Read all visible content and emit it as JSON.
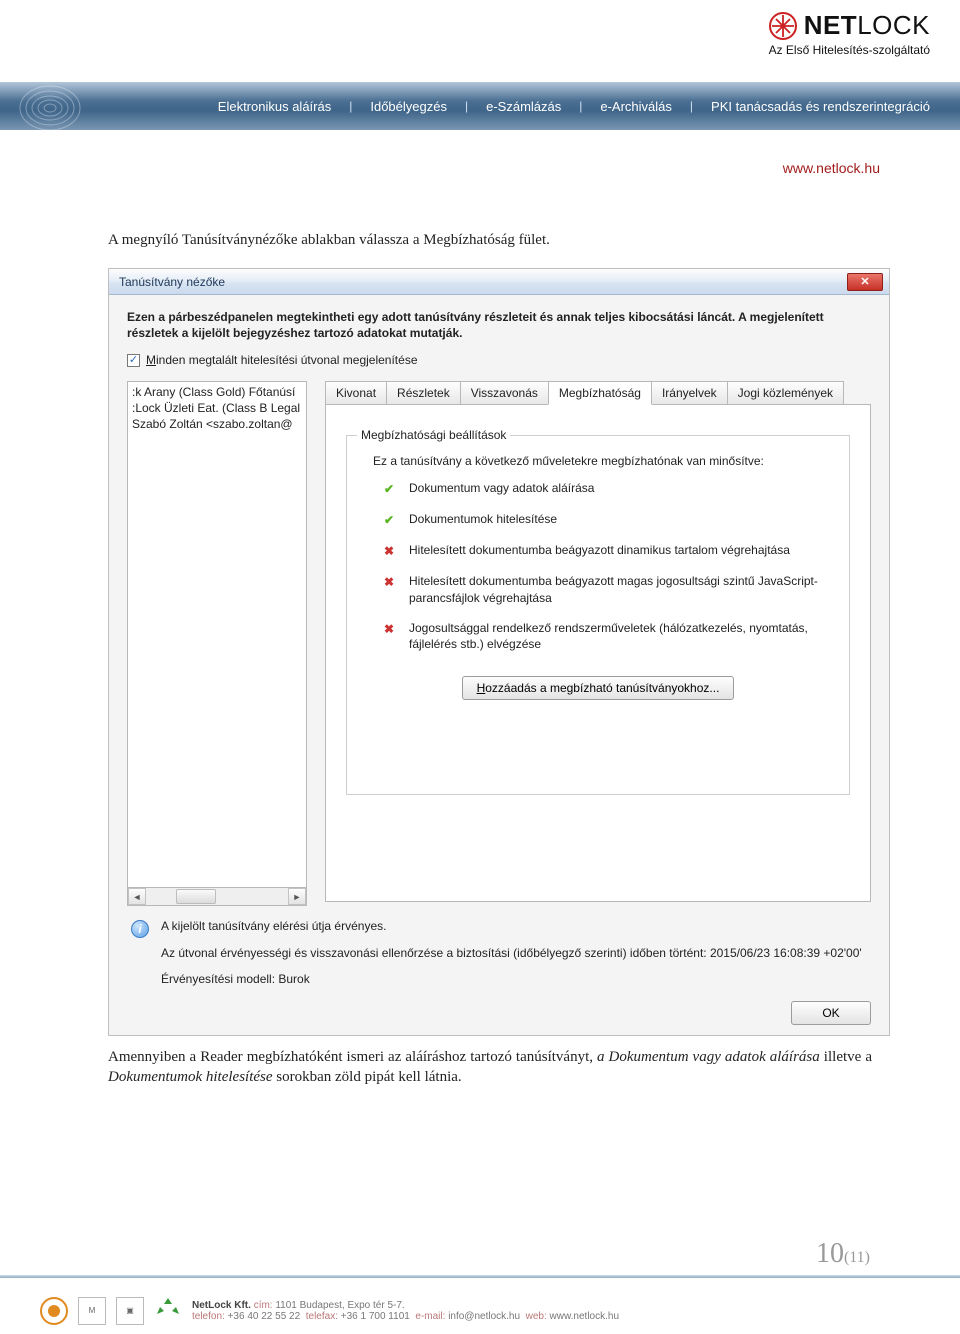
{
  "header": {
    "brand_bold": "NET",
    "brand_thin": "LOCK",
    "tagline": "Az Első Hitelesítés-szolgáltató",
    "nav": [
      "Elektronikus aláírás",
      "Időbélyegzés",
      "e-Számlázás",
      "e-Archiválás",
      "PKI tanácsadás és rendszerintegráció"
    ],
    "url": "www.netlock.hu"
  },
  "para1": "A megnyíló Tanúsítványnézőke ablakban válassza a Megbízhatóság fület.",
  "para2_full": "Amennyiben a Reader megbízhatóként ismeri az aláíráshoz tartozó tanúsítványt, a Dokumentum vagy adatok aláírása illetve a Dokumentumok hitelesítése sorokban zöld pipát kell látnia.",
  "dialog": {
    "title": "Tanúsítvány nézőke",
    "desc": "Ezen a párbeszédpanelen megtekintheti egy adott tanúsítvány részleteit és annak teljes kibocsátási láncát. A megjelenített részletek a kijelölt bejegyzéshez tartozó adatokat mutatják.",
    "checkbox_label": "Minden megtalált hitelesítési útvonal megjelenítése",
    "cert_list": [
      ":k Arany (Class Gold) Főtanúsí",
      ":Lock Üzleti Eat. (Class B Legal",
      "  Szabó Zoltán <szabo.zoltan@"
    ],
    "tabs": [
      "Kivonat",
      "Részletek",
      "Visszavonás",
      "Megbízhatóság",
      "Irányelvek",
      "Jogi közlemények"
    ],
    "active_tab": "Megbízhatóság",
    "group_title": "Megbízhatósági beállítások",
    "group_intro": "Ez a tanúsítvány a következő műveletekre megbízhatónak van minősítve:",
    "items": [
      {
        "ok": true,
        "text": "Dokumentum vagy adatok aláírása"
      },
      {
        "ok": true,
        "text": "Dokumentumok hitelesítése"
      },
      {
        "ok": false,
        "text": "Hitelesített dokumentumba beágyazott dinamikus tartalom végrehajtása"
      },
      {
        "ok": false,
        "text": "Hitelesített dokumentumba beágyazott magas jogosultsági szintű JavaScript-parancsfájlok végrehajtása"
      },
      {
        "ok": false,
        "text": "Jogosultsággal rendelkező rendszerműveletek (hálózatkezelés, nyomtatás, fájlelérés stb.) elvégzése"
      }
    ],
    "add_button": "Hozzáadás a megbízható tanúsítványokhoz...",
    "status1": "A kijelölt tanúsítvány elérési útja érvényes.",
    "status2": "Az útvonal érvényességi és visszavonási ellenőrzése a biztosítási (időbélyegző szerinti) időben történt: 2015/06/23 16:08:39 +02'00'",
    "status3": "Érvényesítési modell: Burok",
    "ok_button": "OK"
  },
  "page": {
    "current": "10",
    "total": "(11)"
  },
  "footer": {
    "company": "NetLock Kft.",
    "addr_label": "cím:",
    "addr": "1101 Budapest, Expo tér 5-7.",
    "tel_label": "telefon:",
    "tel": "+36 40 22 55 22",
    "fax_label": "telefax:",
    "fax": "+36 1 700 1101",
    "mail_label": "e-mail:",
    "mail": "info@netlock.hu",
    "web_label": "web:",
    "web": "www.netlock.hu"
  }
}
